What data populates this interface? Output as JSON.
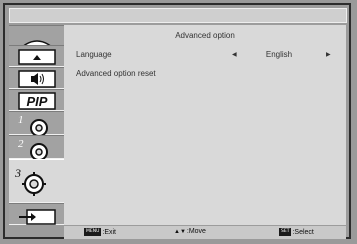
{
  "menu": {
    "title": "Advanced option",
    "rows": [
      {
        "label": "Language",
        "value": "English"
      },
      {
        "label": "Advanced option reset"
      }
    ]
  },
  "sidebar": {
    "tabs": [
      {
        "icon": "picture-icon"
      },
      {
        "icon": "screen-icon"
      },
      {
        "icon": "audio-icon"
      },
      {
        "icon": "pip-icon",
        "text": "PIP"
      },
      {
        "icon": "config1-icon",
        "number": "1"
      },
      {
        "icon": "config2-icon",
        "number": "2"
      },
      {
        "icon": "config3-icon",
        "number": "3"
      },
      {
        "icon": "input-icon"
      }
    ]
  },
  "footer": {
    "exit_key": "MENU",
    "exit_label": ":Exit",
    "move_key": "▲▼",
    "move_label": ":Move",
    "select_key": "SET",
    "select_label": ":Select"
  },
  "colors": {
    "frame": "#9a9a9a",
    "panel": "#d9d9d9",
    "header": "#cfcfcf",
    "footer": "#c9c9c9"
  }
}
